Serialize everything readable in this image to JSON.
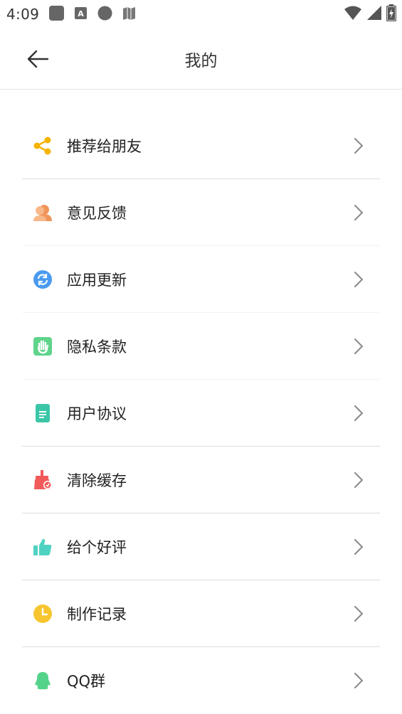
{
  "status_bar": {
    "time": "4:09",
    "left_icons": [
      "app-square-icon",
      "font-a-icon",
      "circle-icon",
      "book-icon"
    ],
    "right_icons": [
      "wifi-icon",
      "signal-icon",
      "battery-icon"
    ]
  },
  "header": {
    "title": "我的",
    "back_icon": "arrow-left-icon"
  },
  "menu": {
    "items": [
      {
        "label": "推荐给朋友",
        "icon": "share-icon",
        "color": "#F5B400"
      },
      {
        "label": "意见反馈",
        "icon": "feedback-icon",
        "color": "#F0955A"
      },
      {
        "label": "应用更新",
        "icon": "refresh-icon",
        "color": "#4A9BF0"
      },
      {
        "label": "隐私条款",
        "icon": "privacy-hand-icon",
        "color": "#5FD48A"
      },
      {
        "label": "用户协议",
        "icon": "document-icon",
        "color": "#3CC6A8"
      },
      {
        "label": "清除缓存",
        "icon": "broom-icon",
        "color": "#F25A5A"
      },
      {
        "label": "给个好评",
        "icon": "thumbs-up-icon",
        "color": "#4FD2C2"
      },
      {
        "label": "制作记录",
        "icon": "clock-icon",
        "color": "#F7C530"
      },
      {
        "label": "QQ群",
        "icon": "qq-icon",
        "color": "#53D38A"
      }
    ]
  }
}
